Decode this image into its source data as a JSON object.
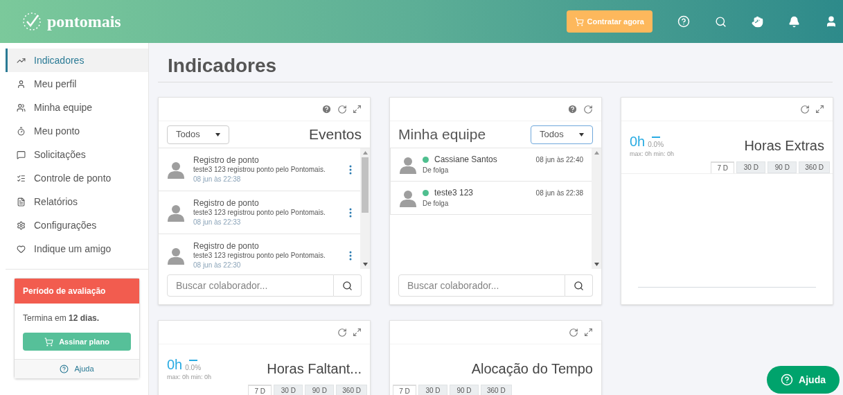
{
  "header": {
    "logo": "pontomais",
    "cta": "Contratar agora"
  },
  "sidebar": {
    "items": [
      {
        "label": "Indicadores",
        "selected": true
      },
      {
        "label": "Meu perfil",
        "selected": false
      },
      {
        "label": "Minha equipe",
        "selected": false
      },
      {
        "label": "Meu ponto",
        "selected": false
      },
      {
        "label": "Solicitações",
        "selected": false
      },
      {
        "label": "Controle de ponto",
        "selected": false
      },
      {
        "label": "Relatórios",
        "selected": false
      },
      {
        "label": "Configurações",
        "selected": false
      },
      {
        "label": "Indique um amigo",
        "selected": false
      }
    ],
    "trial": {
      "title": "Período de avaliação",
      "text": "Termina em **12 dias.**",
      "button": "Assinar plano",
      "help": "Ajuda"
    }
  },
  "page_title": "Indicadores",
  "widgets": [
    {
      "kind": "events",
      "title": "Eventos",
      "tools": [
        {
          "kind": "help"
        },
        {
          "kind": "refresh"
        },
        {
          "kind": "expand"
        }
      ],
      "filter": "Todos",
      "items": [
        {
          "title": "Registro de ponto",
          "text": "teste3 123 registrou ponto pelo Pontomais.",
          "time": "08 jun às 22:38"
        },
        {
          "title": "Registro de ponto",
          "text": "teste3 123 registrou ponto pelo Pontomais.",
          "time": "08 jun às 22:33"
        },
        {
          "title": "Registro de ponto",
          "text": "teste3 123 registrou ponto pelo Pontomais.",
          "time": "08 jun às 22:30"
        }
      ],
      "search_placeholder": "Buscar colaborador..."
    },
    {
      "kind": "team",
      "title": "Minha equipe",
      "tools": [
        {
          "kind": "help"
        },
        {
          "kind": "refresh"
        }
      ],
      "filter": "Todos",
      "members": [
        {
          "name": "Cassiane Santos",
          "status": "De folga",
          "time": "08 jun às 22:40",
          "color": "#4fbf8f"
        },
        {
          "name": "teste3 123",
          "status": "De folga",
          "time": "08 jun às 22:38",
          "color": "#4fbf8f"
        }
      ],
      "search_placeholder": "Buscar colaborador..."
    },
    {
      "kind": "metric",
      "title": "Horas Extras",
      "tools": [
        {
          "kind": "refresh"
        },
        {
          "kind": "expand"
        }
      ],
      "value": "0h",
      "percent": "0.0%",
      "range": "max: 0h min: 0h",
      "tabs": [
        {
          "label": "7 D",
          "selected": true
        },
        {
          "label": "30 D",
          "selected": false
        },
        {
          "label": "90 D",
          "selected": false
        },
        {
          "label": "360 D",
          "selected": false
        }
      ]
    },
    {
      "kind": "metric",
      "title": "Horas Faltant...",
      "tools": [
        {
          "kind": "refresh"
        },
        {
          "kind": "expand"
        }
      ],
      "value": "0h",
      "percent": "0.0%",
      "range": "max: 0h min: 0h",
      "tabs": [
        {
          "label": "7 D",
          "selected": true
        },
        {
          "label": "30 D",
          "selected": false
        },
        {
          "label": "90 D",
          "selected": false
        },
        {
          "label": "360 D",
          "selected": false
        }
      ]
    },
    {
      "kind": "metric",
      "title": "Alocação do Tempo",
      "tools": [
        {
          "kind": "refresh"
        },
        {
          "kind": "expand"
        }
      ],
      "tabs": [
        {
          "label": "7 D",
          "selected": true
        },
        {
          "label": "30 D",
          "selected": false
        },
        {
          "label": "90 D",
          "selected": false
        },
        {
          "label": "360 D",
          "selected": false
        }
      ]
    }
  ],
  "help_button": "Ajuda"
}
